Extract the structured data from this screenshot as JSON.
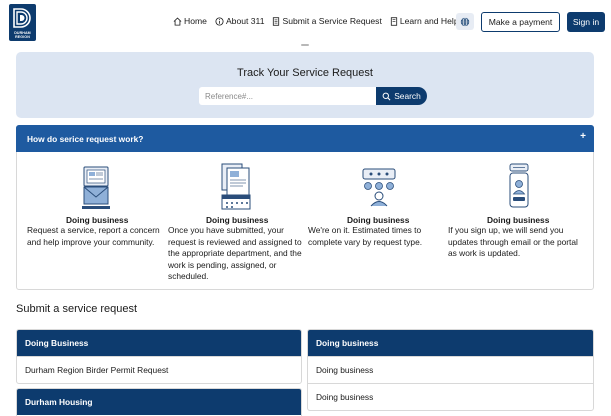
{
  "header": {
    "logo_text": "DURHAM REGION",
    "nav": [
      {
        "label": "Home",
        "icon": "home-icon"
      },
      {
        "label": "About 311",
        "icon": "info-icon"
      },
      {
        "label": "Submit a Service Request",
        "icon": "document-icon"
      },
      {
        "label": "Learn and Help",
        "icon": "book-icon"
      }
    ],
    "language_icon": "globe-icon",
    "payment_label": "Make a payment",
    "signin_label": "Sign in"
  },
  "track": {
    "title": "Track Your Service Request",
    "placeholder": "Reference#...",
    "value": "",
    "search_label": "Search"
  },
  "accordion": {
    "title": "How do serice request work?",
    "toggle": "+",
    "steps": [
      {
        "title": "Doing business",
        "description": "Request a service, report a concern and help improve your community.",
        "icon": "laptop-mail-icon"
      },
      {
        "title": "Doing business",
        "description": "Once you have submitted, your request is reviewed and assigned to the appropriate department, and the work is pending, assigned, or scheduled.",
        "icon": "calendar-clipboard-icon"
      },
      {
        "title": "Doing business",
        "description": "We're on it. Estimated times to complete vary by request type.",
        "icon": "team-assign-icon"
      },
      {
        "title": "Doing business",
        "description": "If you sign up, we will send you updates through email or the portal as work is updated.",
        "icon": "phone-notification-icon"
      }
    ]
  },
  "submit": {
    "heading": "Submit a service request",
    "cards": [
      {
        "title": "Doing Business",
        "items": [
          "Durham Region Birder Permit Request"
        ]
      },
      {
        "title": "Doing business",
        "items": [
          "Doing business",
          "Doing business"
        ]
      },
      {
        "title": "Durham Housing",
        "items": []
      }
    ]
  },
  "colors": {
    "brand_navy": "#0d3b6e",
    "accordion_blue": "#1e5aa0",
    "panel_bg": "#dce5f2"
  }
}
